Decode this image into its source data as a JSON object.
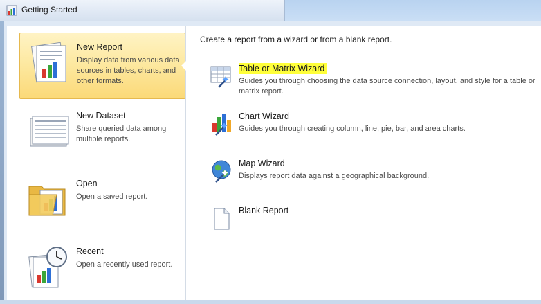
{
  "window": {
    "title": "Getting Started"
  },
  "nav": {
    "items": [
      {
        "title": "New Report",
        "description": "Display data from various data sources in tables, charts, and other formats.",
        "selected": true,
        "icon": "report-icon"
      },
      {
        "title": "New Dataset",
        "description": "Share queried data among multiple reports.",
        "selected": false,
        "icon": "dataset-icon"
      },
      {
        "title": "Open",
        "description": "Open a saved report.",
        "selected": false,
        "icon": "folder-icon"
      },
      {
        "title": "Recent",
        "description": "Open a recently used report.",
        "selected": false,
        "icon": "recent-clock-icon"
      }
    ]
  },
  "main": {
    "header": "Create a report from a wizard or from a blank report.",
    "options": [
      {
        "title": "Table or Matrix Wizard",
        "description": "Guides you through choosing the data source connection, layout, and style for a table or matrix report.",
        "highlighted": true,
        "icon": "table-wizard-icon"
      },
      {
        "title": "Chart Wizard",
        "description": "Guides you through creating column, line, pie, bar, and area charts.",
        "highlighted": false,
        "icon": "chart-wizard-icon"
      },
      {
        "title": "Map Wizard",
        "description": "Displays report data against a geographical background.",
        "highlighted": false,
        "icon": "map-wizard-icon"
      },
      {
        "title": "Blank Report",
        "description": "",
        "highlighted": false,
        "icon": "blank-report-icon"
      }
    ]
  },
  "colors": {
    "selection": "#fbd978",
    "highlight": "#ffff3a",
    "chart_red": "#d9382e",
    "chart_green": "#3aa63a",
    "chart_blue": "#2d6fd6"
  }
}
